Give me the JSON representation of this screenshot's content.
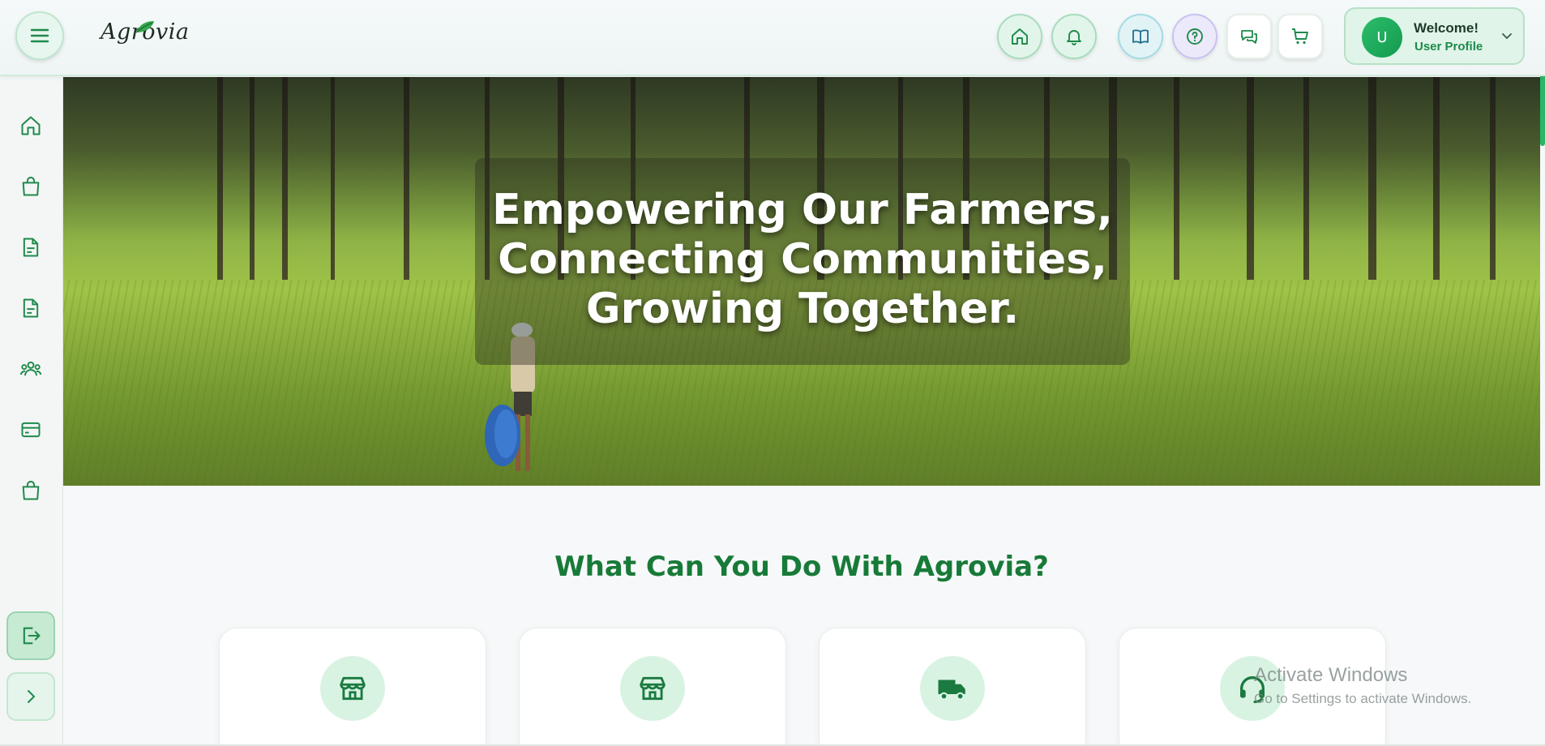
{
  "app": {
    "logo_text": "Agrovia"
  },
  "header": {
    "icons": [
      {
        "name": "home-icon"
      },
      {
        "name": "bell-icon"
      },
      {
        "name": "book-icon"
      },
      {
        "name": "help-icon"
      },
      {
        "name": "chat-icon"
      },
      {
        "name": "cart-icon"
      }
    ],
    "profile": {
      "avatar_letter": "U",
      "welcome": "Welcome!",
      "subtitle": "User Profile"
    }
  },
  "sidebar": {
    "items": [
      {
        "name": "home-icon"
      },
      {
        "name": "shopping-bag-icon"
      },
      {
        "name": "document-icon"
      },
      {
        "name": "document-icon"
      },
      {
        "name": "users-icon"
      },
      {
        "name": "credit-card-icon"
      },
      {
        "name": "shopping-bag-icon"
      }
    ],
    "logout_icon": "logout-icon",
    "expand_icon": "chevron-right-icon"
  },
  "hero": {
    "line1": "Empowering Our Farmers,",
    "line2": "Connecting Communities,",
    "line3": "Growing Together."
  },
  "section": {
    "title": "What Can You Do With Agrovia?",
    "cards": [
      {
        "icon": "store-icon"
      },
      {
        "icon": "store-icon"
      },
      {
        "icon": "truck-icon"
      },
      {
        "icon": "headset-icon"
      }
    ]
  },
  "watermark": {
    "title": "Activate Windows",
    "subtitle": "Go to Settings to activate Windows."
  },
  "colors": {
    "brand_green": "#187a38",
    "accent_green": "#1d9a52",
    "light_green": "#d9f3e2"
  }
}
